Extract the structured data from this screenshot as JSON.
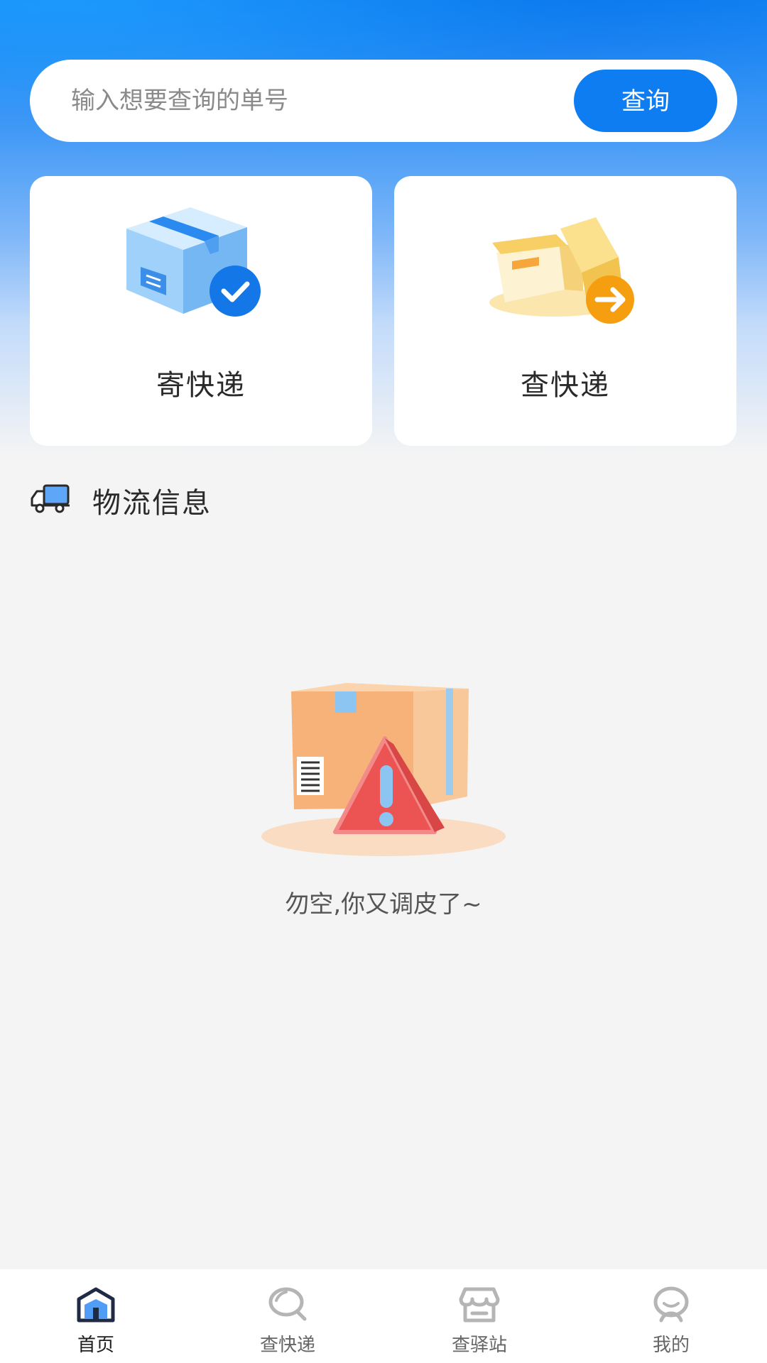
{
  "search": {
    "placeholder": "输入想要查询的单号",
    "button_label": "查询"
  },
  "cards": {
    "send_label": "寄快递",
    "query_label": "查快递"
  },
  "section": {
    "title": "物流信息"
  },
  "empty_state": {
    "message": "勿空,你又调皮了~"
  },
  "bottom_nav": {
    "items": [
      {
        "label": "首页",
        "icon": "home-icon",
        "active": true
      },
      {
        "label": "查快递",
        "icon": "search-icon",
        "active": false
      },
      {
        "label": "查驿站",
        "icon": "store-icon",
        "active": false
      },
      {
        "label": "我的",
        "icon": "user-icon",
        "active": false
      }
    ]
  },
  "colors": {
    "primary": "#0f7df2",
    "card_bg": "#ffffff",
    "page_bg": "#f4f4f4",
    "orange": "#f7a11a",
    "warning_red": "#ef5a5a"
  }
}
